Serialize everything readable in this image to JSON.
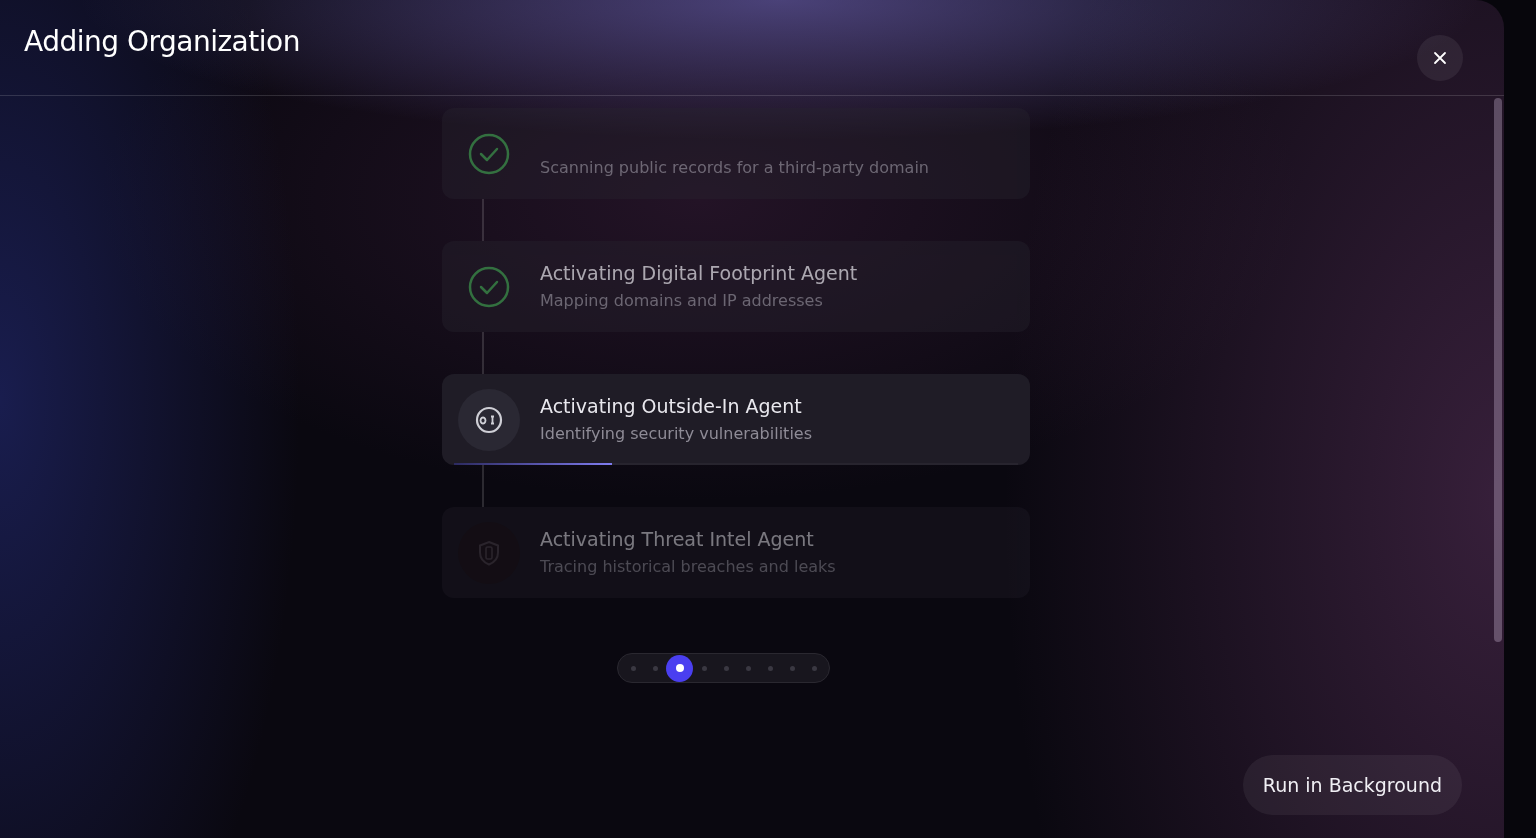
{
  "dialog": {
    "title": "Adding Organization"
  },
  "steps": [
    {
      "kind": "done",
      "description": "Scanning public records for a third-party domain"
    },
    {
      "kind": "done",
      "title": "Activating Digital Footprint Agent",
      "description": "Mapping domains and IP addresses"
    },
    {
      "kind": "active",
      "title": "Activating Outside-In Agent",
      "description": "Identifying security vulnerabilities",
      "level": 0.28
    },
    {
      "kind": "pending",
      "title": "Activating Threat Intel Agent",
      "description": "Tracing historical breaches and leaks"
    }
  ],
  "pagination": [
    {
      "selected": false
    },
    {
      "selected": false
    },
    {
      "selected": true
    },
    {
      "selected": false
    },
    {
      "selected": false
    },
    {
      "selected": false
    },
    {
      "selected": false
    },
    {
      "selected": false
    },
    {
      "selected": false
    }
  ],
  "buttons": {
    "run_in_background": "Run in Background"
  }
}
